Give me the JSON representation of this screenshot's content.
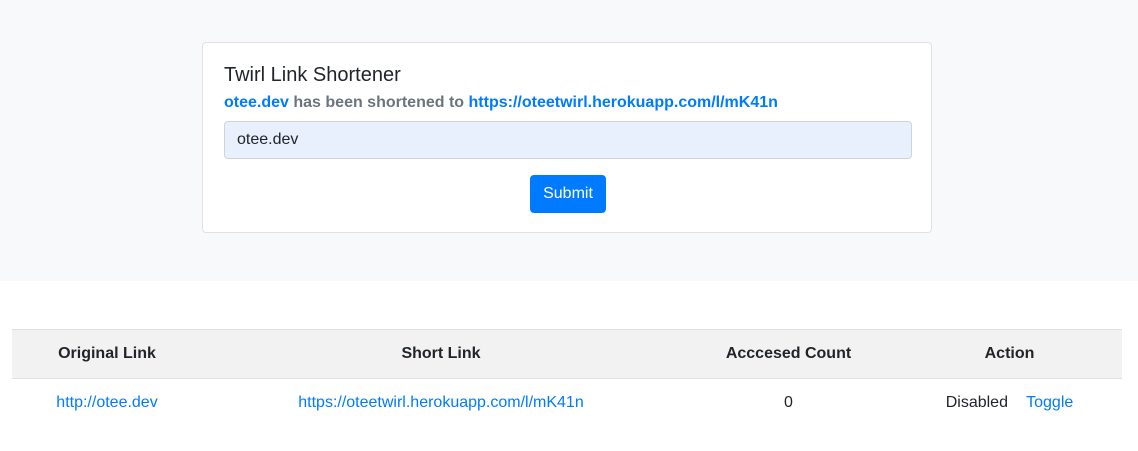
{
  "app": {
    "title": "Twirl Link Shortener"
  },
  "status": {
    "original": "otee.dev",
    "middle_text": "has been shortened to",
    "short": "https://oteetwirl.herokuapp.com/l/mK41n"
  },
  "form": {
    "input_value": "otee.dev",
    "submit_label": "Submit"
  },
  "table": {
    "headers": [
      "Original Link",
      "Short Link",
      "Acccesed Count",
      "Action"
    ],
    "rows": [
      {
        "original_link": "http://otee.dev",
        "short_link": "https://oteetwirl.herokuapp.com/l/mK41n",
        "access_count": "0",
        "status": "Disabled",
        "action_label": "Toggle"
      }
    ]
  },
  "colors": {
    "accent": "#007bff",
    "muted_text": "#6c757d",
    "hero_background": "#f8f9fa",
    "input_autofill": "#e8f0fe",
    "table_header_background": "#f2f2f2"
  }
}
